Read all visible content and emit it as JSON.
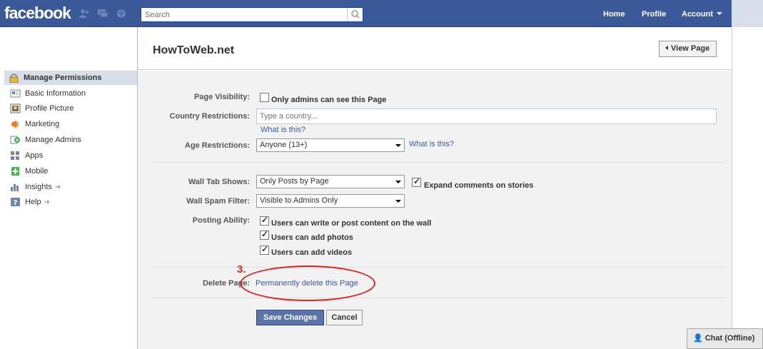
{
  "topbar": {
    "logo": "facebook",
    "search_placeholder": "Search",
    "nav": [
      "Home",
      "Profile",
      "Account"
    ]
  },
  "sidebar": {
    "items": [
      {
        "label": "Manage Permissions",
        "icon": "lock-icon",
        "active": true
      },
      {
        "label": "Basic Information",
        "icon": "info-card-icon"
      },
      {
        "label": "Profile Picture",
        "icon": "picture-icon"
      },
      {
        "label": "Marketing",
        "icon": "megaphone-icon"
      },
      {
        "label": "Manage Admins",
        "icon": "admins-icon"
      },
      {
        "label": "Apps",
        "icon": "apps-icon"
      },
      {
        "label": "Mobile",
        "icon": "mobile-icon"
      },
      {
        "label": "Insights",
        "icon": "insights-icon",
        "arrow": true
      },
      {
        "label": "Help",
        "icon": "help-icon",
        "arrow": true
      }
    ]
  },
  "page": {
    "title": "HowToWeb.net",
    "view_page": "View Page"
  },
  "form": {
    "visibility_label": "Page Visibility:",
    "visibility_option": "Only admins can see this Page",
    "country_label": "Country Restrictions:",
    "country_placeholder": "Type a country...",
    "what_is_this": "What is this?",
    "age_label": "Age Restrictions:",
    "age_value": "Anyone (13+)",
    "wall_tab_label": "Wall Tab Shows:",
    "wall_tab_value": "Only Posts by Page",
    "expand_comments": "Expand comments on stories",
    "spam_label": "Wall Spam Filter:",
    "spam_value": "Visible to Admins Only",
    "posting_label": "Posting Ability:",
    "posting_options": [
      "Users can write or post content on the wall",
      "Users can add photos",
      "Users can add videos"
    ],
    "delete_label": "Delete Page:",
    "delete_link": "Permanently delete this Page",
    "save": "Save Changes",
    "cancel": "Cancel"
  },
  "annotation": {
    "step": "3."
  },
  "chat": {
    "label": "Chat (Offline)"
  }
}
